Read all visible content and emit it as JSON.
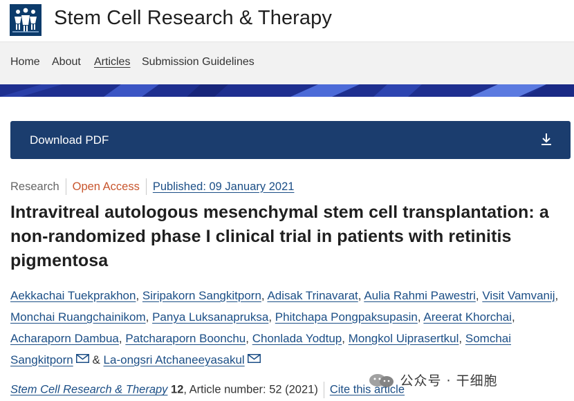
{
  "header": {
    "logo_icon": "people-group-logo-icon",
    "journal_title": "Stem Cell Research & Therapy"
  },
  "nav": {
    "items": [
      {
        "label": "Home",
        "active": false
      },
      {
        "label": "About",
        "active": false
      },
      {
        "label": "Articles",
        "active": true
      },
      {
        "label": "Submission Guidelines",
        "active": false
      }
    ]
  },
  "download": {
    "label": "Download PDF",
    "icon": "download-icon"
  },
  "meta": {
    "type": "Research",
    "access": "Open Access",
    "published": "Published: 09 January 2021"
  },
  "article": {
    "title": "Intravitreal autologous mesenchymal stem cell transplantation: a non-randomized phase I clinical trial in patients with retinitis pigmentosa"
  },
  "authors": [
    "Aekkachai Tuekprakhon",
    "Siripakorn Sangkitporn",
    "Adisak Trinavarat",
    "Aulia Rahmi Pawestri",
    "Visit Vamvanij",
    "Monchai Ruangchainikom",
    "Panya Luksanapruksa",
    "Phitchapa Pongpaksupasin",
    "Areerat Khorchai",
    "Acharaporn Dambua",
    "Patcharaporn Boonchu",
    "Chonlada Yodtup",
    "Mongkol Uiprasertkul",
    "Somchai Sangkitporn",
    "La-ongsri Atchaneeyasakul"
  ],
  "author_separators": {
    "comma": ",",
    "and": "&"
  },
  "citation": {
    "journal": "Stem Cell Research & Therapy",
    "volume": "12",
    "article_info": ", Article number: 52 (2021)",
    "cite_label": "Cite this article"
  },
  "watermark": {
    "text": "公众号 · 干细胞"
  },
  "colors": {
    "primary_blue": "#1b3d6e",
    "link_blue": "#1b4e86",
    "open_access_orange": "#c8552d",
    "banner_blue": "#1e2f8f"
  }
}
